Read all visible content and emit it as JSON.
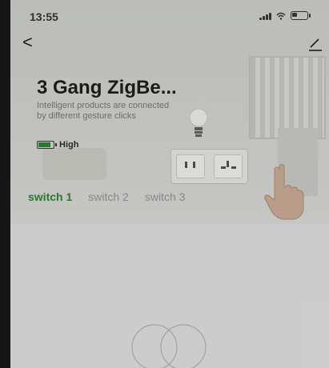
{
  "status_bar": {
    "time": "13:55",
    "signal_icon": "signal-icon",
    "wifi_icon": "wifi-icon",
    "battery_icon": "battery-icon"
  },
  "nav": {
    "back_icon": "chevron-left-icon",
    "back_label": "<",
    "edit_icon": "pencil-icon"
  },
  "device": {
    "title": "3 Gang ZigBe...",
    "description": "Intelligent products are connected by different gesture clicks",
    "battery_label": "High",
    "battery_level": "high"
  },
  "tabs": [
    {
      "label": "switch 1",
      "active": true
    },
    {
      "label": "switch 2",
      "active": false
    },
    {
      "label": "switch 3",
      "active": false
    }
  ],
  "colors": {
    "accent": "#2e8b33",
    "background": "#e9e9e9"
  }
}
